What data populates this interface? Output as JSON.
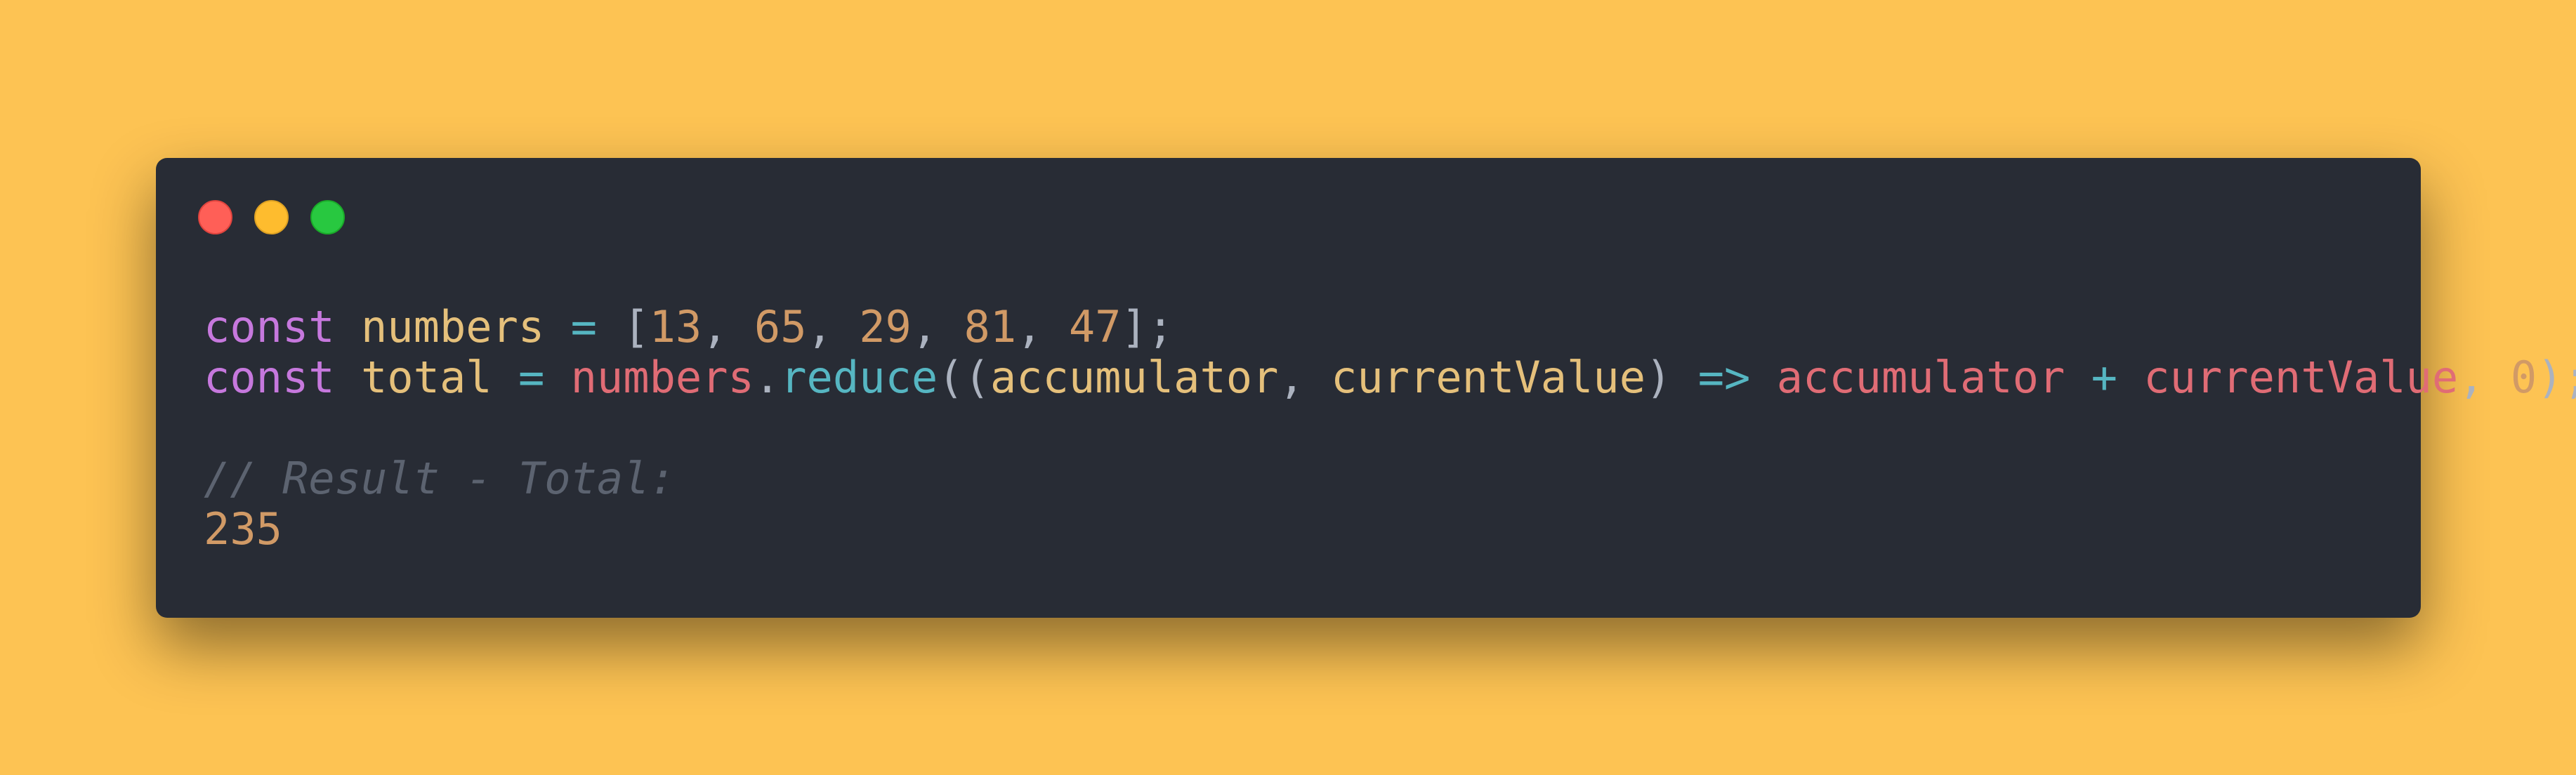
{
  "window": {
    "controls": [
      "close",
      "minimize",
      "maximize"
    ]
  },
  "code": {
    "line1": {
      "kw": "const",
      "name": "numbers",
      "eq": "=",
      "open": "[",
      "nums": [
        "13",
        "65",
        "29",
        "81",
        "47"
      ],
      "close": "];"
    },
    "line2": {
      "kw": "const",
      "name": "total",
      "eq": "=",
      "obj": "numbers",
      "dot": ".",
      "method": "reduce",
      "open": "((",
      "p1": "accumulator",
      "comma": ",",
      "p2": "currentValue",
      "closep": ")",
      "arrow": "=>",
      "a": "accumulator",
      "plus": "+",
      "b": "currentValue",
      "init": "0",
      "end": ");"
    },
    "comment": "// Result - Total:",
    "result": "235"
  },
  "colors": {
    "background": "#fdc353",
    "window": "#282c35",
    "keyword": "#c678dd",
    "variable": "#e5c07b",
    "operator": "#56b6c2",
    "number": "#d19a66",
    "object": "#e06c75",
    "comment": "#5c6370"
  }
}
